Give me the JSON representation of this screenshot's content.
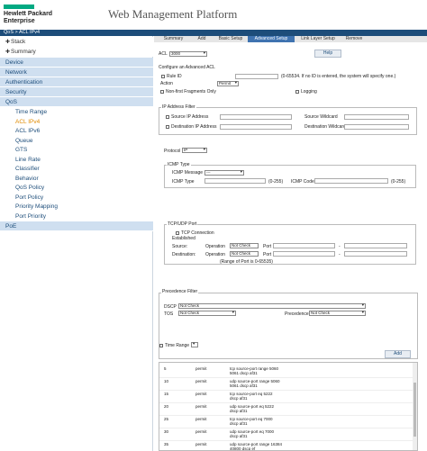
{
  "header": {
    "logo_line1": "Hewlett Packard",
    "logo_line2": "Enterprise",
    "title": "Web Management Platform"
  },
  "breadcrumb": "QoS > ACL IPv4",
  "sidebar": {
    "top": [
      {
        "label": "Stack"
      },
      {
        "label": "Summary"
      }
    ],
    "cats1": [
      "Device",
      "Network",
      "Authentication",
      "Security",
      "QoS"
    ],
    "qos_items": [
      "Time Range",
      "ACL IPv4",
      "ACL IPv6",
      "Queue",
      "GTS",
      "Line Rate",
      "Classifier",
      "Behavior",
      "QoS Policy",
      "Port Policy",
      "Priority Mapping",
      "Port Priority"
    ],
    "active": "ACL IPv4",
    "cats2": [
      "PoE"
    ]
  },
  "tabs": [
    "Summary",
    "Add",
    "Basic Setup",
    "Advanced Setup",
    "Link Layer Setup",
    "Remove"
  ],
  "active_tab": "Advanced Setup",
  "form": {
    "acl_label": "ACL",
    "acl_value": "3000",
    "help": "Help",
    "configure_title": "Configure an Advanced ACL",
    "rule_id": "Rule ID",
    "rule_hint": "(0-65534. If no ID is entered, the system will specify one.)",
    "action": "Action",
    "action_value": "Permit",
    "non_first": "Non-first Fragments Only",
    "logging": "Logging",
    "ip_filter": "IP Address Filter",
    "src_ip": "Source IP Address",
    "src_wild": "Source Wildcard",
    "dst_ip": "Destination IP Address",
    "dst_wild": "Destination Wildcard",
    "protocol": "Protocol",
    "protocol_value": "IP",
    "icmp_type_title": "ICMP Type",
    "icmp_message": "ICMP Message",
    "icmp_message_value": "---",
    "icmp_type": "ICMP Type",
    "icmp_code": "ICMP Code",
    "range255": "(0-255)",
    "tcpudp": "TCP/UDP Port",
    "tcp_conn": "TCP Connection",
    "established": "Established",
    "source": "Source:",
    "destination": "Destination:",
    "operation": "Operation",
    "not_check": "Not Check",
    "port": "Port",
    "dash": "-",
    "port_range": "(Range of Port is 0-65535)",
    "prec_filter": "Precedence Filter",
    "dscp": "DSCP",
    "tos": "TOS",
    "precedence": "Precedence",
    "time_range": "Time Range",
    "add": "Add"
  },
  "rules": [
    {
      "id": "5",
      "action": "permit",
      "desc1": "tcp source-port range 5060",
      "desc2": "5061 dscp af31"
    },
    {
      "id": "10",
      "action": "permit",
      "desc1": "udp source-port range 5060",
      "desc2": "5061 dscp af31"
    },
    {
      "id": "15",
      "action": "permit",
      "desc1": "tcp source-port eq 5222",
      "desc2": "dscp af31"
    },
    {
      "id": "20",
      "action": "permit",
      "desc1": "udp source-port eq 5222",
      "desc2": "dscp af31"
    },
    {
      "id": "25",
      "action": "permit",
      "desc1": "tcp source-port eq 7000",
      "desc2": "dscp af31"
    },
    {
      "id": "30",
      "action": "permit",
      "desc1": "udp source-port eq 7000",
      "desc2": "dscp af31"
    },
    {
      "id": "35",
      "action": "permit",
      "desc1": "udp source-port range 16384",
      "desc2": "40800 dscp ef"
    }
  ]
}
